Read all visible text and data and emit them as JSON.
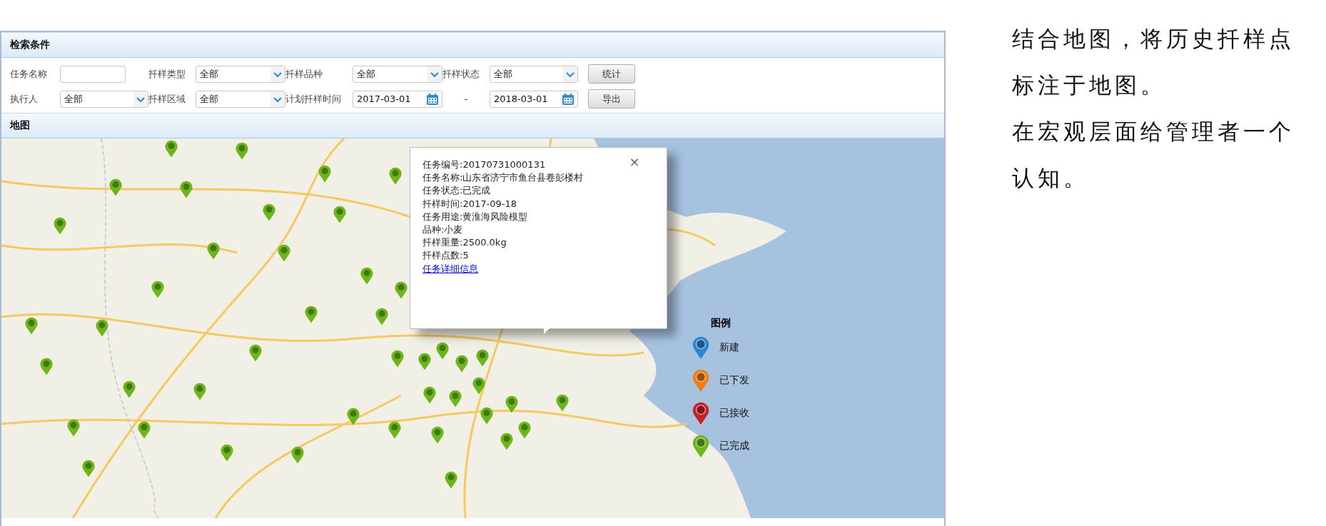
{
  "search_panel": {
    "title": "检索条件",
    "fields": [
      {
        "kind": "text",
        "label": "任务名称"
      },
      {
        "kind": "select",
        "label": "扦样类型",
        "value": "全部"
      },
      {
        "kind": "select",
        "label": "扦样品种",
        "value": "全部"
      },
      {
        "kind": "select",
        "label": "扦样状态",
        "value": "全部"
      },
      {
        "kind": "select",
        "label": "执行人",
        "value": "全部"
      },
      {
        "kind": "select",
        "label": "扦样区域",
        "value": "全部"
      },
      {
        "kind": "date_range",
        "label": "计划扦样时间",
        "from": "2017-03-01",
        "separator": "-",
        "to": "2018-03-01"
      }
    ],
    "buttons": [
      "统计",
      "导出"
    ]
  },
  "map_panel": {
    "title": "地图",
    "popup": {
      "close": "×",
      "lines": [
        "任务编号:20170731000131",
        "任务名称:山东省济宁市鱼台县卷彭楼村",
        "任务状态:已完成",
        "扦样时间:2017-09-18",
        "任务用途:黄淮海风险模型",
        "品种:小麦",
        "扦样重量:2500.0kg",
        "扦样点数:5"
      ],
      "link": "任务详细信息"
    },
    "legend": {
      "title": "图例",
      "items": [
        {
          "label": "新建",
          "color": "#2a86d0"
        },
        {
          "label": "已下发",
          "color": "#f07d10"
        },
        {
          "label": "已接收",
          "color": "#c8202a"
        },
        {
          "label": "已完成",
          "color": "#6db51a"
        }
      ]
    }
  },
  "note": [
    "结合地图，将历史扦样点标注于地图。",
    "在宏观层面给管理者一个认知。"
  ]
}
